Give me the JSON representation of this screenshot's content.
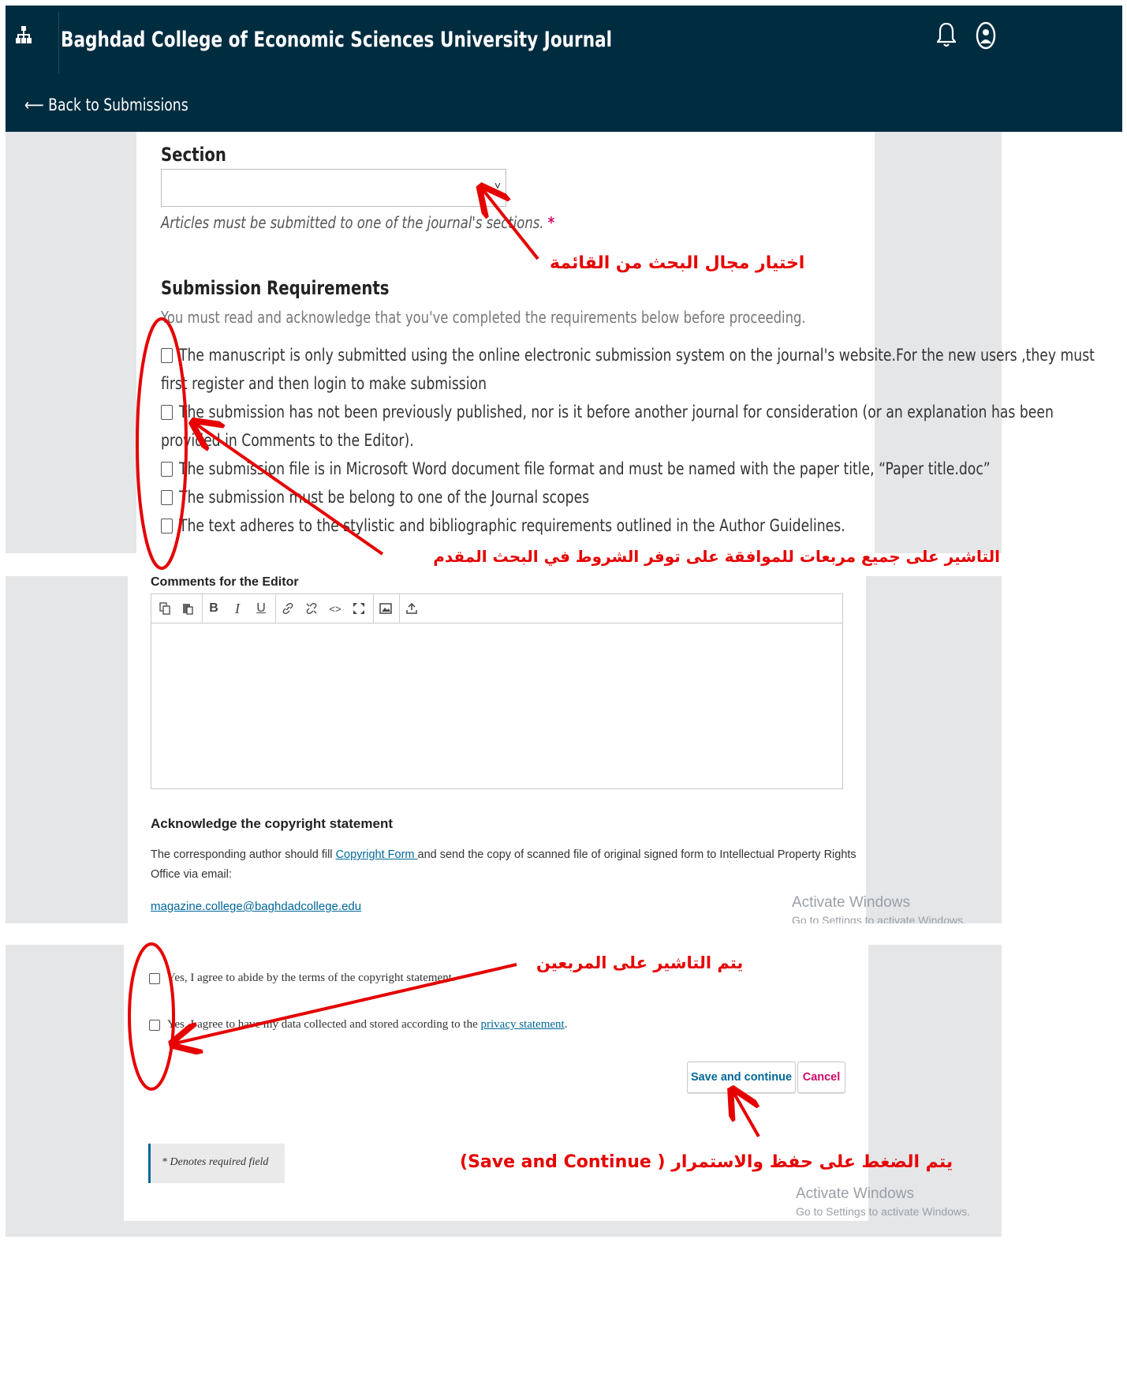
{
  "header": {
    "journal_title": "Baghdad College of Economic Sciences University Journal",
    "back_link": "⟵ Back to Submissions",
    "icons": [
      "sitemap-icon",
      "bell-icon",
      "user-icon"
    ]
  },
  "section": {
    "label": "Section",
    "selected_value": "",
    "description": "Articles must be submitted to one of the journal's sections.",
    "required_mark": "*"
  },
  "requirements": {
    "title": "Submission Requirements",
    "intro": "You must read and acknowledge that you've completed the requirements below before proceeding.",
    "items": [
      {
        "line1": "The manuscript is only submitted using the online electronic submission system on the journal's website.For the new users ,they must",
        "line2": "first register and then login to make submission"
      },
      {
        "line1": "The submission has not been previously published, nor is it before another journal for consideration (or an explanation has been",
        "line2": "provided in Comments to the Editor)."
      },
      {
        "line1": "The submission file is in Microsoft Word document file format and must be named with the paper title, “Paper title.doc”",
        "line2": ""
      },
      {
        "line1": "The submission must be belong to one of the Journal scopes",
        "line2": ""
      },
      {
        "line1": "The text adheres to the stylistic and bibliographic requirements outlined in the Author Guidelines.",
        "line2": ""
      }
    ]
  },
  "comments": {
    "label": "Comments for the Editor",
    "toolbar": [
      "copy-icon",
      "paste-icon",
      "bold-icon",
      "italic-icon",
      "underline-icon",
      "link-icon",
      "unlink-icon",
      "code-icon",
      "fullscreen-icon",
      "image-icon",
      "upload-icon"
    ],
    "toolbar_glyphs": {
      "bold": "B",
      "italic": "I",
      "underline": "U",
      "code": "<>"
    },
    "value": ""
  },
  "copyright": {
    "title": "Acknowledge the copyright statement",
    "text_before": "The corresponding author should fill ",
    "form_link": "Copyright Form ",
    "text_after": " and send the copy of scanned file of original signed form to Intellectual Property Rights",
    "text_line2": "Office via email:",
    "email": "magazine.college@baghdadcollege.edu",
    "agree_terms": "Yes, I agree to abide by the terms of the copyright statement.",
    "agree_data_before": "Yes, I agree to have my data collected and stored according to the ",
    "privacy_link": "privacy statement",
    "agree_data_after": "."
  },
  "actions": {
    "save_label": "Save and continue",
    "cancel_label": "Cancel"
  },
  "required_note": "* Denotes required field",
  "watermark": {
    "line1": "Activate Windows",
    "line2": "Go to Settings to activate Windows."
  },
  "annotations": {
    "select_section": "اختيار مجال البحث  من القائمة",
    "check_all": "التاشير على جميع مربعات للموافقة على توفر الشروط في البحث المقدم",
    "check_two": "يتم التاشير على المربعين",
    "click_save": "يتم الضغط على حفظ والاستمرار ( Save and Continue)"
  },
  "colors": {
    "header_bg": "#002c40",
    "annotation_red": "#e60000",
    "link_blue": "#006798",
    "cancel_red": "#d00a6c"
  }
}
